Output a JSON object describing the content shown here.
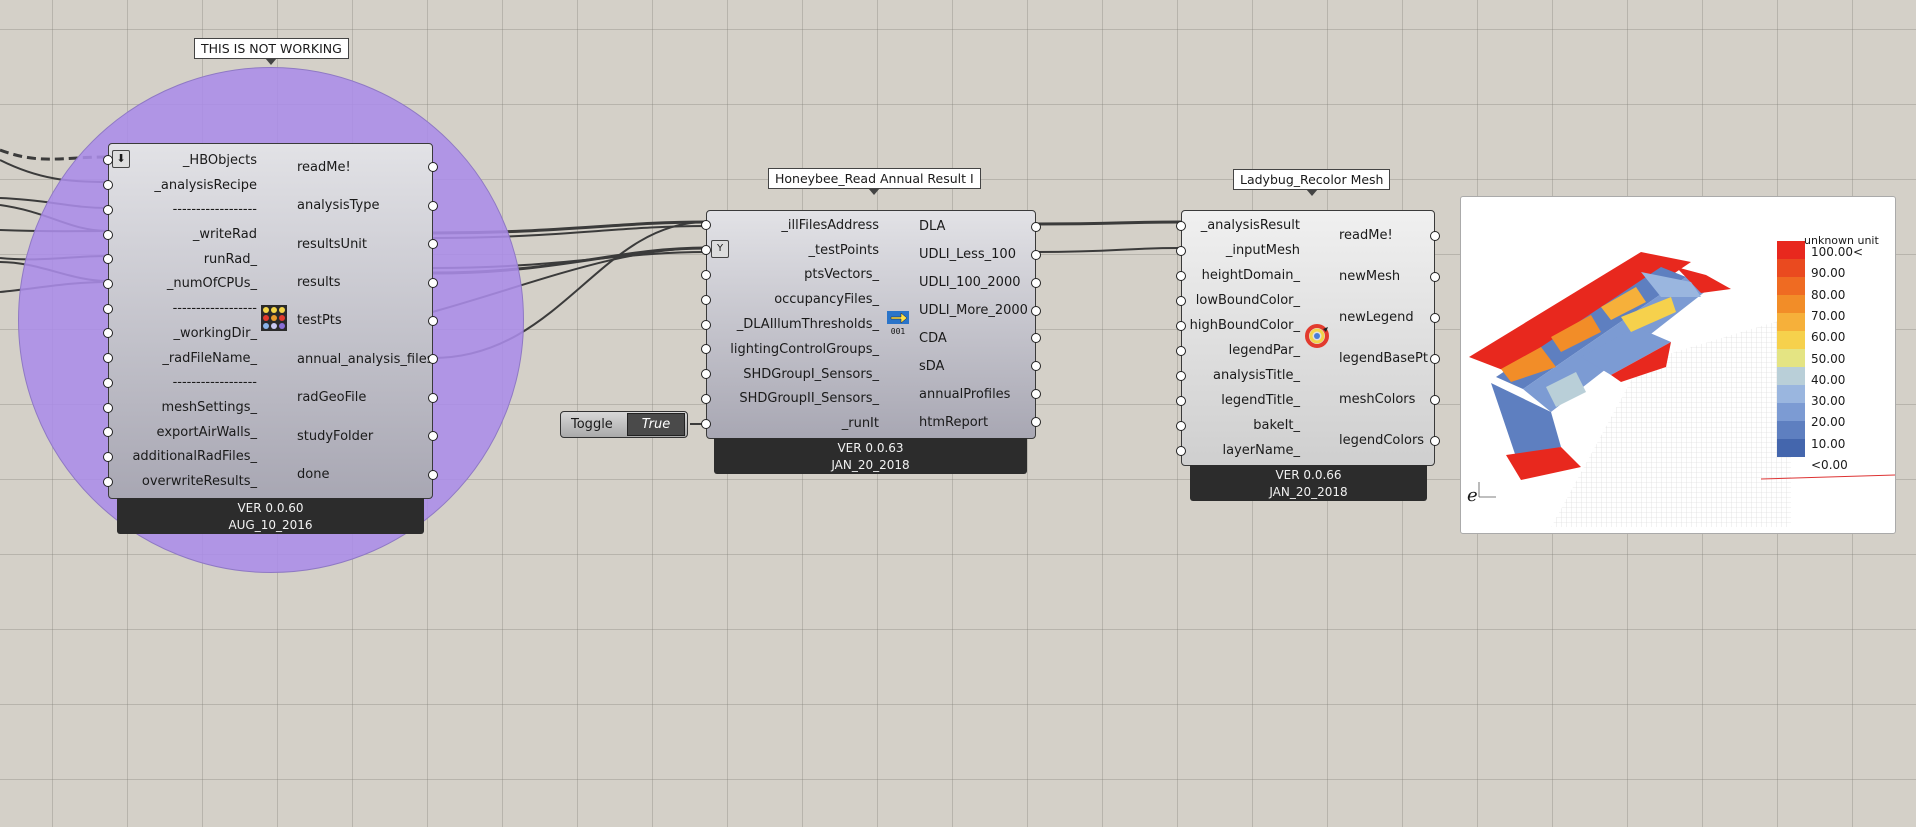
{
  "group": {
    "balloon": "THIS IS NOT WORKING"
  },
  "run_daylight": {
    "inputs": [
      "_HBObjects",
      "_analysisRecipe",
      "------------------",
      "_writeRad",
      "runRad_",
      "_numOfCPUs_",
      "------------------",
      "_workingDir_",
      "_radFileName_",
      "------------------",
      "meshSettings_",
      "exportAirWalls_",
      "additionalRadFiles_",
      "overwriteResults_"
    ],
    "outputs": [
      "readMe!",
      "analysisType",
      "resultsUnit",
      "results",
      "testPts",
      "annual_analysis_files",
      "radGeoFile",
      "studyFolder",
      "done"
    ],
    "version": "VER 0.0.60",
    "date": "AUG_10_2016",
    "icon": "colored-dots-grid-icon"
  },
  "read_annual": {
    "balloon": "Honeybee_Read Annual Result I",
    "inputs": [
      "_illFilesAddress",
      "_testPoints",
      "ptsVectors_",
      "occupancyFiles_",
      "_DLAIllumThresholds_",
      "lightingControlGroups_",
      "SHDGroupI_Sensors_",
      "SHDGroupII_Sensors_",
      "_runIt"
    ],
    "outputs": [
      "DLA",
      "UDLI_Less_100",
      "UDLI_100_2000",
      "UDLI_More_2000",
      "CDA",
      "sDA",
      "annualProfiles",
      "htmReport"
    ],
    "version": "VER 0.0.63",
    "date": "JAN_20_2018",
    "icon": "arrow-001-icon"
  },
  "toggle": {
    "label": "Toggle",
    "value": "True"
  },
  "recolor": {
    "balloon": "Ladybug_Recolor Mesh",
    "inputs": [
      "_analysisResult",
      "_inputMesh",
      "heightDomain_",
      "lowBoundColor_",
      "highBoundColor_",
      "legendPar_",
      "analysisTitle_",
      "legendTitle_",
      "bakeIt_",
      "layerName_"
    ],
    "outputs": [
      "readMe!",
      "newMesh",
      "newLegend",
      "legendBasePt",
      "meshColors",
      "legendColors"
    ],
    "version": "VER 0.0.66",
    "date": "JAN_20_2018",
    "icon": "ladybug-recolor-icon"
  },
  "preview": {
    "legend_title": "unknown unit",
    "legend_labels": [
      "100.00<",
      "90.00",
      "80.00",
      "70.00",
      "60.00",
      "50.00",
      "40.00",
      "30.00",
      "20.00",
      "10.00",
      "<0.00"
    ],
    "legend_colors": [
      "#e8281e",
      "#ea4a1f",
      "#ef6b22",
      "#f28d28",
      "#f6b03a",
      "#f6d14c",
      "#e4e483",
      "#b9cfd8",
      "#9ab6df",
      "#7c9bd3",
      "#5e7fc0",
      "#4466ad"
    ]
  }
}
